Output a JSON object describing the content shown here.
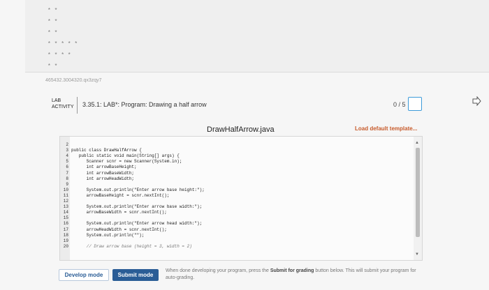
{
  "top_lines": [
    "* *",
    "* *",
    "* *",
    "* * * * *",
    "* * * *",
    "* *"
  ],
  "breadcrumb": "465432.3004320.qx3zqy7",
  "lab": {
    "label_line1": "LAB",
    "label_line2": "ACTIVITY",
    "title": "3.35.1: LAB*: Program: Drawing a half arrow",
    "score": "0 / 5"
  },
  "editor": {
    "file_name": "DrawHalfArrow.java",
    "load_default_label": "Load default template...",
    "lines": [
      {
        "num": "2",
        "text": ""
      },
      {
        "num": "3",
        "text": "public class DrawHalfArrow {"
      },
      {
        "num": "4",
        "text": "   public static void main(String[] args) {"
      },
      {
        "num": "5",
        "text": "      Scanner scnr = new Scanner(System.in);"
      },
      {
        "num": "6",
        "text": "      int arrowBaseHeight;"
      },
      {
        "num": "7",
        "text": "      int arrowBaseWidth;"
      },
      {
        "num": "8",
        "text": "      int arrowHeadWidth;"
      },
      {
        "num": "9",
        "text": ""
      },
      {
        "num": "10",
        "text": "      System.out.println(\"Enter arrow base height:\");"
      },
      {
        "num": "11",
        "text": "      arrowBaseHeight = scnr.nextInt();"
      },
      {
        "num": "12",
        "text": ""
      },
      {
        "num": "13",
        "text": "      System.out.println(\"Enter arrow base width:\");"
      },
      {
        "num": "14",
        "text": "      arrowBaseWidth = scnr.nextInt();"
      },
      {
        "num": "15",
        "text": ""
      },
      {
        "num": "16",
        "text": "      System.out.println(\"Enter arrow head width:\");"
      },
      {
        "num": "17",
        "text": "      arrowHeadWidth = scnr.nextInt();"
      },
      {
        "num": "18",
        "text": "      System.out.println(\"\");"
      },
      {
        "num": "19",
        "text": ""
      },
      {
        "num": "20",
        "text": "      // Draw arrow base (height = 3, width = 2)"
      }
    ]
  },
  "buttons": {
    "develop": "Develop mode",
    "submit": "Submit mode"
  },
  "help": {
    "before": "When done developing your program, press the ",
    "bold": "Submit for grading",
    "after": " button below. This will submit your program for auto-grading."
  },
  "colors": {
    "accent": "#2a5d96",
    "load_default": "#c75a2a",
    "score_box_border": "#3d9bd9"
  }
}
